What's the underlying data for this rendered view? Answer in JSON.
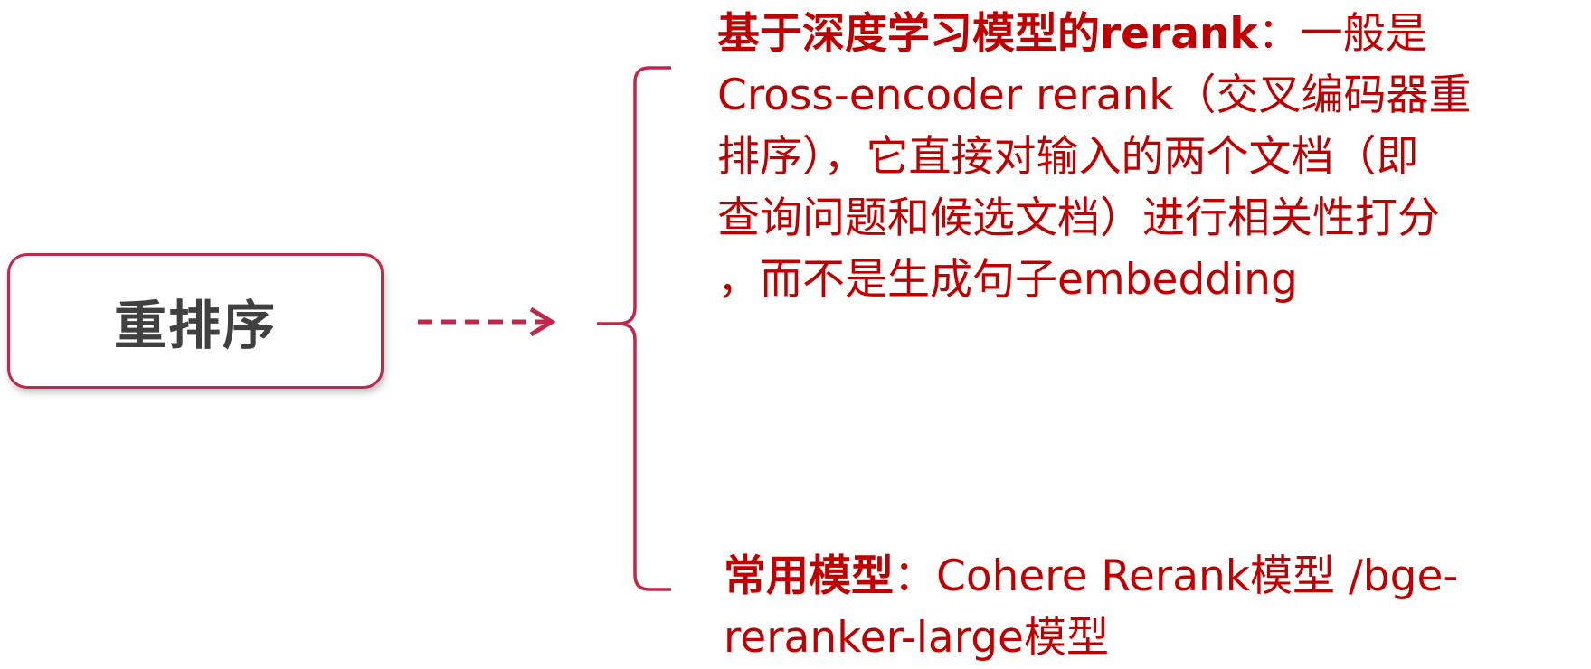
{
  "center_node": {
    "label": "重排序"
  },
  "branches": [
    {
      "lead": "基于深度学习模型的rerank",
      "separator": "：",
      "lines": [
        "一般是",
        "Cross-encoder rerank（交叉编码器重",
        "排序），它直接对输入的两个文档（即",
        "查询问题和候选文档）进行相关性打分",
        "，而不是生成句子embedding"
      ]
    },
    {
      "lead": "常用模型",
      "separator": "：",
      "lines": [
        "Cohere Rerank模型 /bge-",
        "reranker-large模型"
      ]
    }
  ],
  "colors": {
    "accent": "#c0284a",
    "text": "#c00000",
    "node_text": "#404040"
  }
}
